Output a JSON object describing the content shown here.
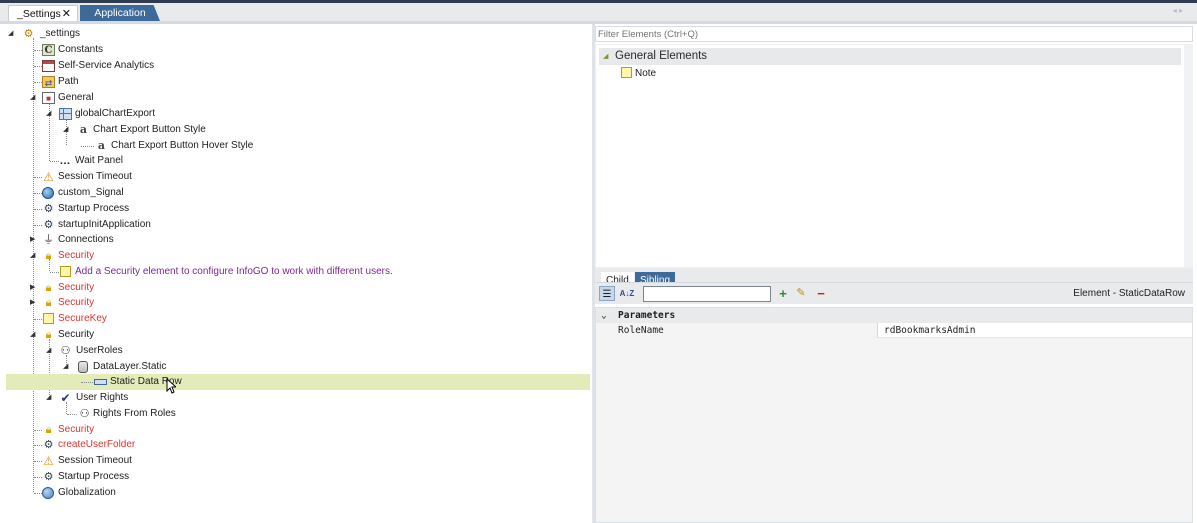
{
  "tabs": [
    {
      "label": "_Settings",
      "active": true,
      "close": "✕"
    },
    {
      "label": "Application",
      "active": false
    }
  ],
  "tree": {
    "nodes": [
      {
        "label": "_settings",
        "icon": "settings-folder-icon",
        "color": "normal"
      },
      {
        "label": "Constants",
        "icon": "constants-icon",
        "color": "normal"
      },
      {
        "label": "Self-Service Analytics",
        "icon": "analytics-window-icon",
        "color": "normal"
      },
      {
        "label": "Path",
        "icon": "path-icon",
        "color": "normal"
      },
      {
        "label": "General",
        "icon": "general-icon",
        "color": "normal"
      },
      {
        "label": "globalChartExport",
        "icon": "grid-icon",
        "color": "normal"
      },
      {
        "label": "Chart Export Button Style",
        "icon": "style-icon",
        "color": "normal"
      },
      {
        "label": "Chart Export Button Hover Style",
        "icon": "style-icon",
        "color": "normal"
      },
      {
        "label": "Wait Panel",
        "icon": "ellipsis-icon",
        "color": "normal"
      },
      {
        "label": "Session Timeout",
        "icon": "warning-icon",
        "color": "normal"
      },
      {
        "label": "custom_Signal",
        "icon": "globe-icon",
        "color": "normal"
      },
      {
        "label": "Startup Process",
        "icon": "gears-icon",
        "color": "normal"
      },
      {
        "label": "startupInitApplication",
        "icon": "gears-icon",
        "color": "normal"
      },
      {
        "label": "Connections",
        "icon": "plug-icon",
        "color": "normal"
      },
      {
        "label": "Security",
        "icon": "lock-icon",
        "color": "red"
      },
      {
        "label": "Add a Security element to configure InfoGO to work with different users.",
        "icon": "note-icon",
        "color": "purple"
      },
      {
        "label": "Security",
        "icon": "lock-icon",
        "color": "red"
      },
      {
        "label": "Security",
        "icon": "lock-icon",
        "color": "red"
      },
      {
        "label": "SecureKey",
        "icon": "note-icon",
        "color": "red"
      },
      {
        "label": "Security",
        "icon": "lock-icon",
        "color": "normal"
      },
      {
        "label": "UserRoles",
        "icon": "roles-icon",
        "color": "normal"
      },
      {
        "label": "DataLayer.Static",
        "icon": "datalayer-icon",
        "color": "normal"
      },
      {
        "label": "Static Data Row",
        "icon": "data-row-icon",
        "color": "normal",
        "selected": true
      },
      {
        "label": "User Rights",
        "icon": "checkmark-icon",
        "color": "normal"
      },
      {
        "label": "Rights From Roles",
        "icon": "rights-icon",
        "color": "normal"
      },
      {
        "label": "Security",
        "icon": "lock-icon",
        "color": "red"
      },
      {
        "label": "createUserFolder",
        "icon": "gears-icon",
        "color": "red"
      },
      {
        "label": "Session Timeout",
        "icon": "warning-icon",
        "color": "normal"
      },
      {
        "label": "Startup Process",
        "icon": "gears-icon",
        "color": "normal"
      },
      {
        "label": "Globalization",
        "icon": "globe-icon",
        "color": "normal"
      }
    ]
  },
  "filter": {
    "placeholder": "Filter Elements (Ctrl+Q)"
  },
  "palette": {
    "group": "General Elements",
    "items": [
      {
        "label": "Note",
        "icon": "note-icon"
      }
    ]
  },
  "child_tabs": {
    "child": "Child",
    "sibling": "Sibling"
  },
  "properties": {
    "element_title": "Element - StaticDataRow",
    "category": "Parameters",
    "rows": [
      {
        "name": "RoleName",
        "value": "rdBookmarksAdmin"
      }
    ]
  },
  "colors": {
    "accent_tab": "#3e6a9a",
    "selection": "#e3ebb9",
    "error_text": "#e0332e",
    "note_text": "#7b2a8f"
  }
}
